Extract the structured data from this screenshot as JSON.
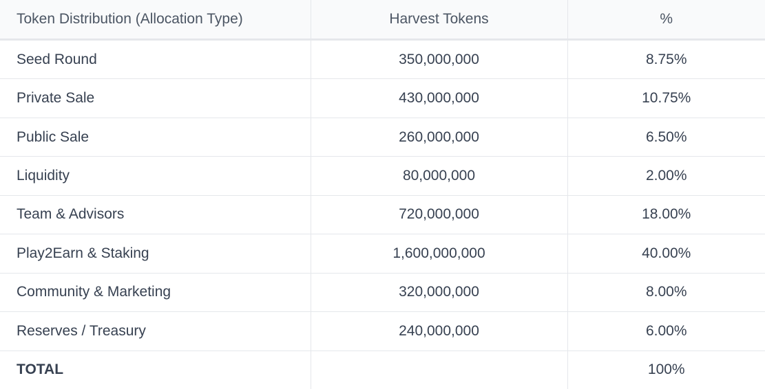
{
  "table": {
    "headers": [
      "Token Distribution (Allocation Type)",
      "Harvest Tokens",
      "%"
    ],
    "rows": [
      {
        "name": "Seed Round",
        "tokens": "350,000,000",
        "percent": "8.75%"
      },
      {
        "name": "Private Sale",
        "tokens": "430,000,000",
        "percent": "10.75%"
      },
      {
        "name": "Public Sale",
        "tokens": "260,000,000",
        "percent": "6.50%"
      },
      {
        "name": "Liquidity",
        "tokens": "80,000,000",
        "percent": "2.00%"
      },
      {
        "name": "Team & Advisors",
        "tokens": "720,000,000",
        "percent": "18.00%"
      },
      {
        "name": "Play2Earn & Staking",
        "tokens": "1,600,000,000",
        "percent": "40.00%"
      },
      {
        "name": "Community & Marketing",
        "tokens": "320,000,000",
        "percent": "8.00%"
      },
      {
        "name": "Reserves / Treasury",
        "tokens": "240,000,000",
        "percent": "6.00%"
      }
    ],
    "total": {
      "label": "TOTAL",
      "tokens": "",
      "percent": "100%"
    }
  }
}
